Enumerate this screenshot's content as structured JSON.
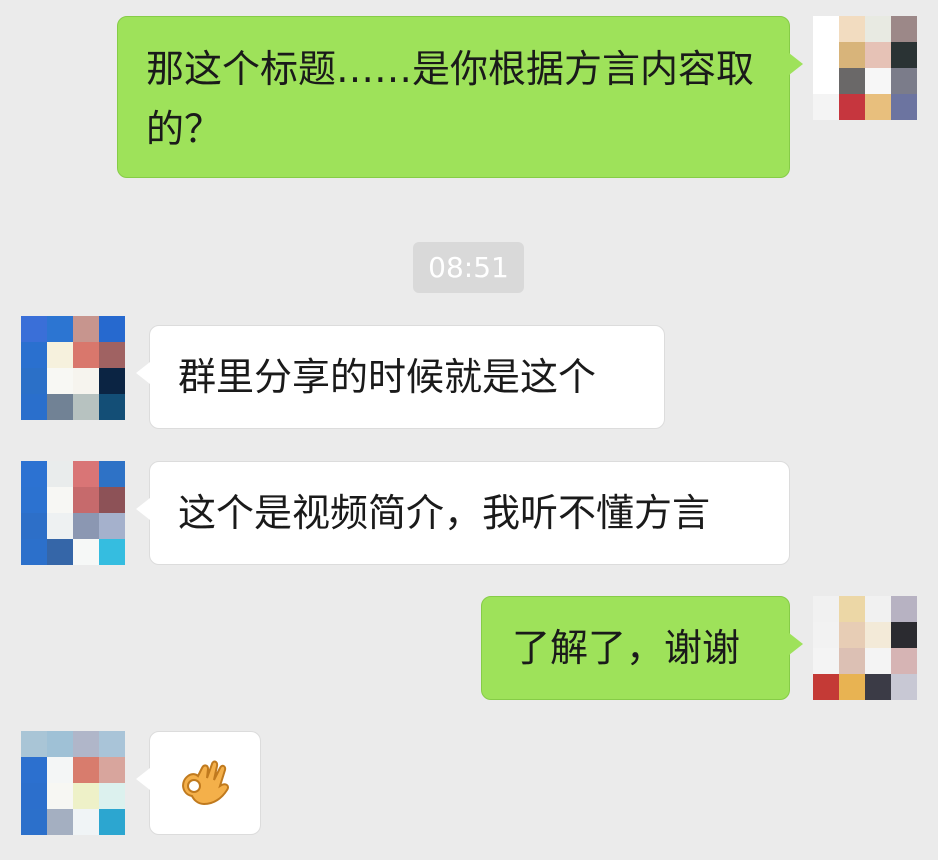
{
  "conversation": {
    "messages": [
      {
        "sender": "me",
        "text": "那这个标题……是你根据方言内容取的？"
      },
      {
        "timestamp": "08:51"
      },
      {
        "sender": "other",
        "text": "群里分享的时候就是这个"
      },
      {
        "sender": "other",
        "text": "这个是视频简介，我听不懂方言"
      },
      {
        "sender": "me",
        "text": "了解了，谢谢"
      },
      {
        "sender": "other",
        "emoji": "ok-hand"
      }
    ]
  },
  "colors": {
    "background": "#ebebeb",
    "my_bubble": "#9ee25a",
    "other_bubble": "#ffffff",
    "timestamp_pill": "#d9d9d9"
  }
}
